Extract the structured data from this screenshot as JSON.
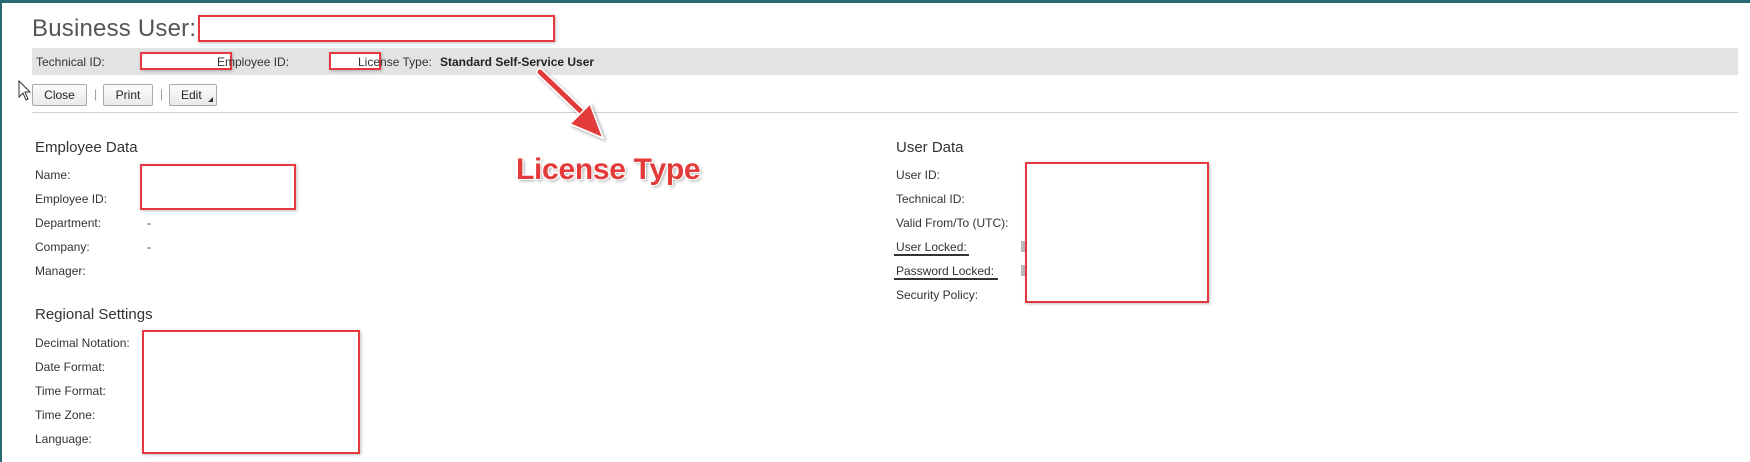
{
  "header": {
    "title": "Business User:"
  },
  "info_bar": {
    "technical_id_label": "Technical ID:",
    "employee_id_label": "Employee ID:",
    "license_type_label": "License Type:",
    "license_type_value": "Standard Self-Service User"
  },
  "toolbar": {
    "close_label": "Close",
    "print_label": "Print",
    "edit_label": "Edit",
    "separator": "|"
  },
  "annotation": {
    "text": "License Type",
    "color": "#e33a3a"
  },
  "employee_data": {
    "title": "Employee Data",
    "fields": [
      {
        "label": "Name:",
        "value": ""
      },
      {
        "label": "Employee ID:",
        "value": ""
      },
      {
        "label": "Department:",
        "value": "-"
      },
      {
        "label": "Company:",
        "value": "-"
      },
      {
        "label": "Manager:",
        "value": ""
      }
    ]
  },
  "regional_settings": {
    "title": "Regional Settings",
    "fields": [
      {
        "label": "Decimal Notation:"
      },
      {
        "label": "Date Format:"
      },
      {
        "label": "Time Format:"
      },
      {
        "label": "Time Zone:"
      },
      {
        "label": "Language:"
      }
    ]
  },
  "user_data": {
    "title": "User Data",
    "fields": [
      {
        "label": "User ID:"
      },
      {
        "label": "Technical ID:"
      },
      {
        "label": "Valid From/To (UTC):"
      },
      {
        "label": "User Locked:"
      },
      {
        "label": "Password Locked:"
      },
      {
        "label": "Security Policy:"
      }
    ]
  },
  "colors": {
    "redaction_border": "#e8383f",
    "info_bar_bg": "#e3e3e3",
    "frame": "#2a6b73"
  }
}
